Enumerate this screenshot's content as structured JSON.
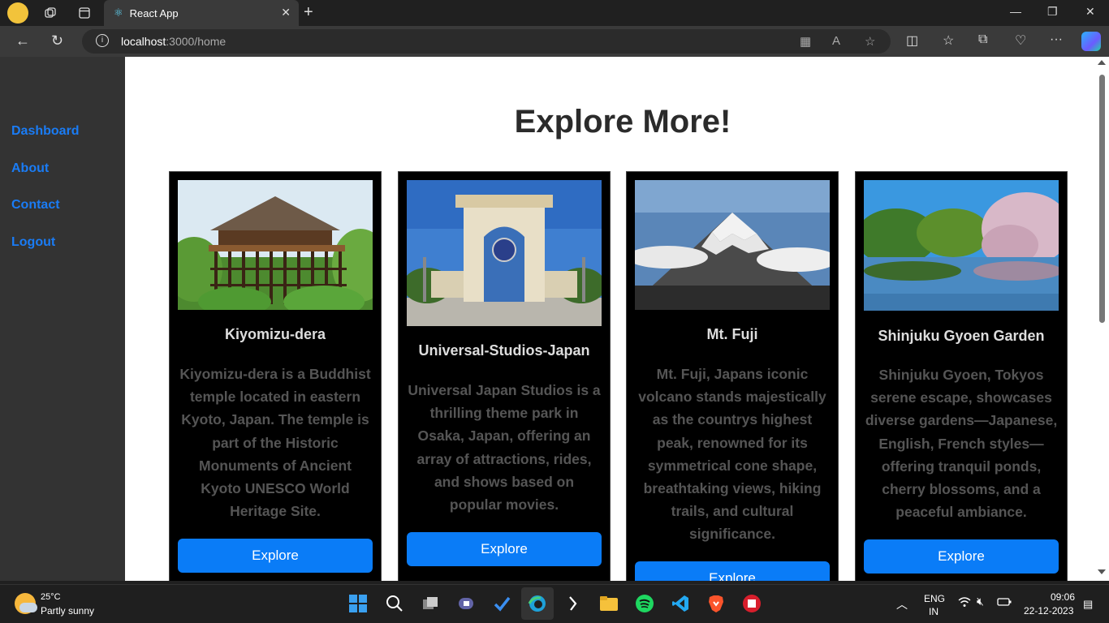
{
  "browser": {
    "tab_title": "React App",
    "url_host": "localhost",
    "url_rest": ":3000/home"
  },
  "sidebar": {
    "items": [
      {
        "label": "Dashboard"
      },
      {
        "label": "About"
      },
      {
        "label": "Contact"
      },
      {
        "label": "Logout"
      }
    ]
  },
  "main": {
    "heading": "Explore More!",
    "cards": [
      {
        "name": "Kiyomizu-dera",
        "description": "Kiyomizu-dera is a Buddhist temple located in eastern Kyoto, Japan. The temple is part of the Historic Monuments of Ancient Kyoto UNESCO World Heritage Site.",
        "button": "Explore"
      },
      {
        "name": "Universal-Studios-Japan",
        "description": "Universal Japan Studios is a thrilling theme park in Osaka, Japan, offering an array of attractions, rides, and shows based on popular movies.",
        "button": "Explore"
      },
      {
        "name": "Mt. Fuji",
        "description": "Mt. Fuji, Japans iconic volcano stands majestically as the countrys highest peak, renowned for its symmetrical cone shape, breathtaking views, hiking trails, and cultural significance.",
        "button": "Explore"
      },
      {
        "name": "Shinjuku Gyoen Garden",
        "description": "Shinjuku Gyoen, Tokyos serene escape, showcases diverse gardens—Japanese, English, French styles—offering tranquil ponds, cherry blossoms, and a peaceful ambiance.",
        "button": "Explore"
      }
    ]
  },
  "taskbar": {
    "weather_temp": "25°C",
    "weather_desc": "Partly sunny",
    "lang_top": "ENG",
    "lang_bottom": "IN",
    "time": "09:06",
    "date": "22-12-2023"
  },
  "colors": {
    "accent": "#0a7cf7",
    "sidebar_link": "#1a7cf5",
    "sidebar_bg": "#333333",
    "card_bg": "#000000"
  }
}
